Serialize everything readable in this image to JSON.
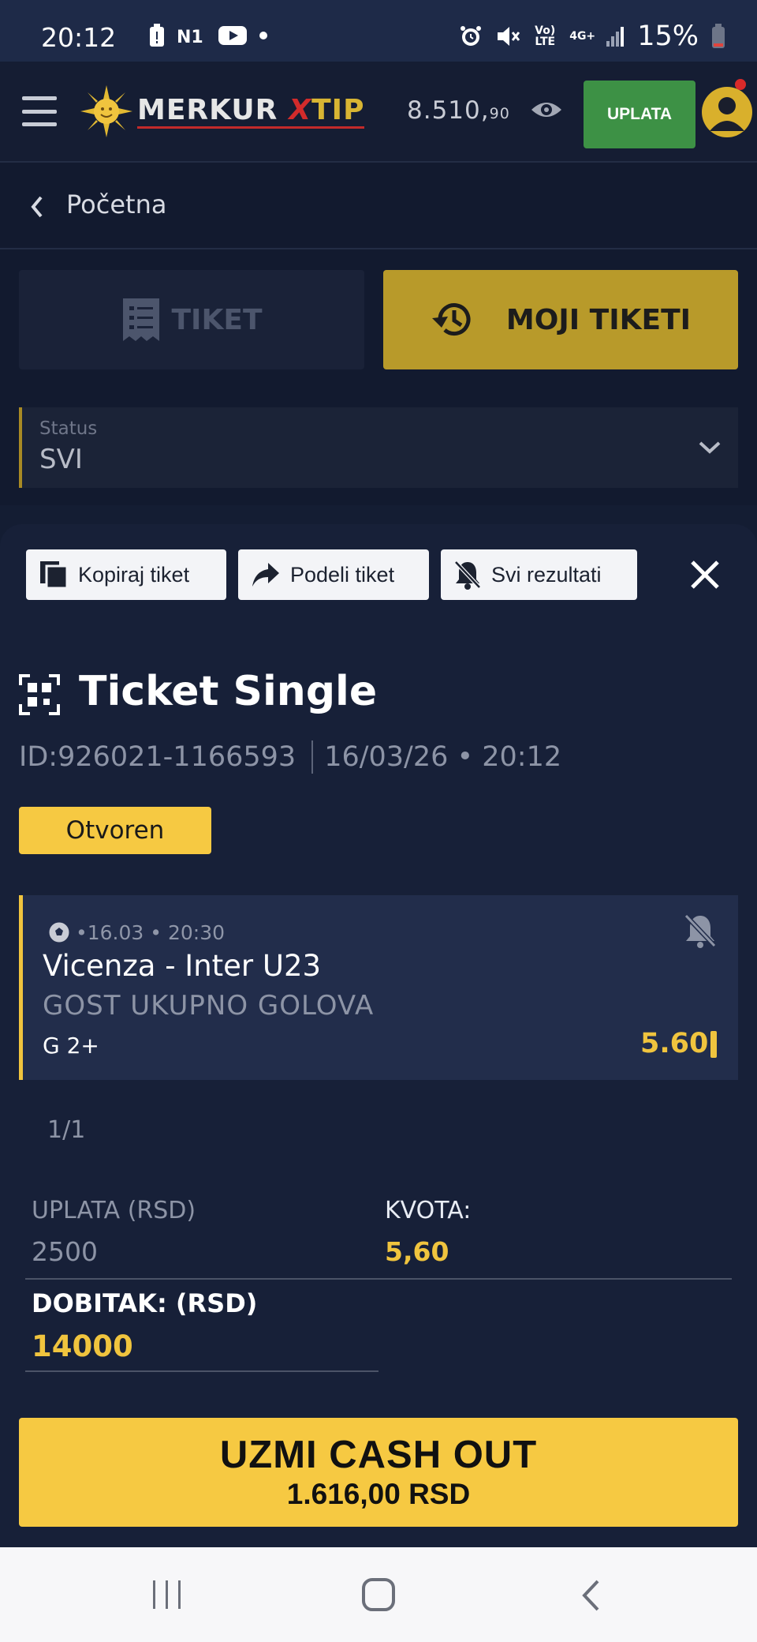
{
  "status_bar": {
    "time": "20:12",
    "left_icons": [
      "battery-saver-icon",
      "n1-app-icon",
      "youtube-icon",
      "notification-dot-icon"
    ],
    "right_icons": [
      "alarm-icon",
      "mute-icon",
      "volte-icon",
      "4g-icon",
      "signal-icon"
    ],
    "volte_label": "Vo) LTE",
    "network_label": "4G+",
    "battery": "15%"
  },
  "header": {
    "logo_main": "MERKUR",
    "logo_x": "X",
    "logo_tip": "TIP",
    "balance_main": "8.510,",
    "balance_decimals": "90",
    "deposit_label": "UPLATA",
    "colors": {
      "deposit": "#3d9145",
      "accent": "#f6c942"
    }
  },
  "breadcrumb": {
    "label": "Početna"
  },
  "tabs": {
    "tiket": "TIKET",
    "moji_tiketi": "MOJI TIKETI"
  },
  "status_filter": {
    "label": "Status",
    "value": "SVI"
  },
  "ticket": {
    "actions": {
      "copy": "Kopiraj tiket",
      "share": "Podeli tiket",
      "all_results": "Svi rezultati"
    },
    "title": "Ticket Single",
    "id": "ID:926021-1166593",
    "datetime": "16/03/26 • 20:12",
    "status_badge": "Otvoren",
    "match": {
      "date": "•16.03 • 20:30",
      "teams": "Vicenza - Inter U23",
      "market": "GOST UKUPNO GOLOVA",
      "pick": "G 2+",
      "odd": "5.60"
    },
    "pager": "1/1",
    "stake_label": "UPLATA (RSD)",
    "stake_value": "2500",
    "odds_label": "KVOTA:",
    "odds_value": "5,60",
    "win_label": "DOBITAK: (RSD)",
    "win_value": "14000",
    "cashout_title": "UZMI CASH OUT",
    "cashout_amount": "1.616,00 RSD"
  }
}
